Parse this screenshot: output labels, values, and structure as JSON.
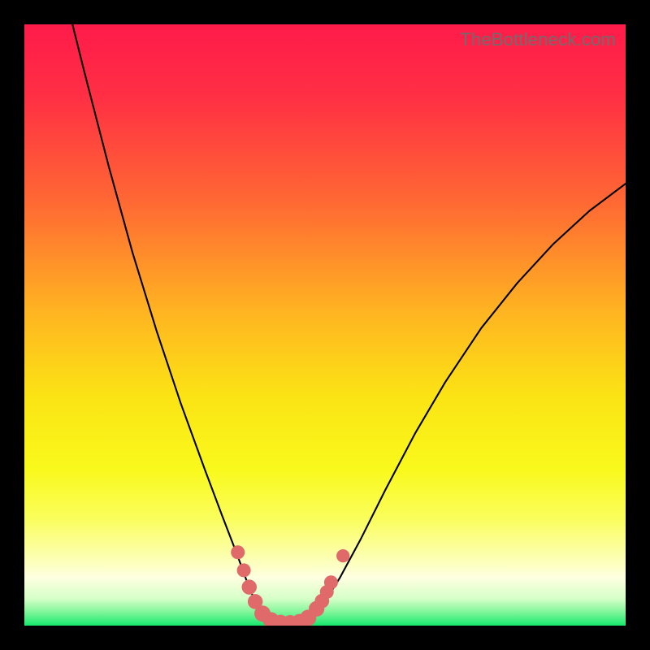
{
  "watermark": "TheBottleneck.com",
  "gradient": {
    "stops": [
      {
        "offset": 0.0,
        "color": "#ff1b4a"
      },
      {
        "offset": 0.12,
        "color": "#ff2f44"
      },
      {
        "offset": 0.3,
        "color": "#ff6a33"
      },
      {
        "offset": 0.48,
        "color": "#ffb521"
      },
      {
        "offset": 0.62,
        "color": "#fbe414"
      },
      {
        "offset": 0.74,
        "color": "#f9f91c"
      },
      {
        "offset": 0.82,
        "color": "#fafe5a"
      },
      {
        "offset": 0.88,
        "color": "#fcffa8"
      },
      {
        "offset": 0.92,
        "color": "#feffe0"
      },
      {
        "offset": 0.955,
        "color": "#d6ffc8"
      },
      {
        "offset": 0.975,
        "color": "#8af79e"
      },
      {
        "offset": 1.0,
        "color": "#17e86e"
      }
    ]
  },
  "chart_data": {
    "type": "line",
    "title": "",
    "xlabel": "",
    "ylabel": "",
    "xlim": [
      0,
      100
    ],
    "ylim": [
      0,
      100
    ],
    "grid": false,
    "curve": [
      {
        "x": 8.0,
        "y": 100.0
      },
      {
        "x": 10.0,
        "y": 92.0
      },
      {
        "x": 14.0,
        "y": 76.5
      },
      {
        "x": 18.0,
        "y": 62.0
      },
      {
        "x": 22.0,
        "y": 49.0
      },
      {
        "x": 26.0,
        "y": 37.0
      },
      {
        "x": 30.0,
        "y": 26.0
      },
      {
        "x": 33.0,
        "y": 18.0
      },
      {
        "x": 35.5,
        "y": 11.5
      },
      {
        "x": 37.5,
        "y": 6.0
      },
      {
        "x": 39.0,
        "y": 2.8
      },
      {
        "x": 40.5,
        "y": 1.0
      },
      {
        "x": 42.5,
        "y": 0.3
      },
      {
        "x": 44.5,
        "y": 0.2
      },
      {
        "x": 46.5,
        "y": 0.5
      },
      {
        "x": 48.0,
        "y": 1.6
      },
      {
        "x": 50.0,
        "y": 4.0
      },
      {
        "x": 52.5,
        "y": 8.0
      },
      {
        "x": 56.0,
        "y": 14.5
      },
      {
        "x": 60.0,
        "y": 22.5
      },
      {
        "x": 65.0,
        "y": 32.0
      },
      {
        "x": 70.0,
        "y": 40.5
      },
      {
        "x": 76.0,
        "y": 49.5
      },
      {
        "x": 82.0,
        "y": 57.0
      },
      {
        "x": 88.0,
        "y": 63.5
      },
      {
        "x": 94.0,
        "y": 69.0
      },
      {
        "x": 100.0,
        "y": 73.5
      }
    ],
    "markers": [
      {
        "x": 35.5,
        "y": 12.2,
        "r": 1.15
      },
      {
        "x": 36.5,
        "y": 9.2,
        "r": 1.15
      },
      {
        "x": 37.4,
        "y": 6.4,
        "r": 1.25
      },
      {
        "x": 38.4,
        "y": 4.0,
        "r": 1.25
      },
      {
        "x": 39.6,
        "y": 2.0,
        "r": 1.35
      },
      {
        "x": 41.0,
        "y": 0.9,
        "r": 1.35
      },
      {
        "x": 42.6,
        "y": 0.4,
        "r": 1.4
      },
      {
        "x": 44.2,
        "y": 0.35,
        "r": 1.4
      },
      {
        "x": 45.8,
        "y": 0.55,
        "r": 1.4
      },
      {
        "x": 47.2,
        "y": 1.3,
        "r": 1.35
      },
      {
        "x": 48.6,
        "y": 2.8,
        "r": 1.3
      },
      {
        "x": 49.5,
        "y": 4.1,
        "r": 1.2
      },
      {
        "x": 50.3,
        "y": 5.6,
        "r": 1.15
      },
      {
        "x": 51.0,
        "y": 7.2,
        "r": 1.15
      },
      {
        "x": 53.0,
        "y": 11.6,
        "r": 1.1
      }
    ],
    "marker_color": "#e06a6a",
    "curve_color": "#000000",
    "curve_width": 2.1
  }
}
